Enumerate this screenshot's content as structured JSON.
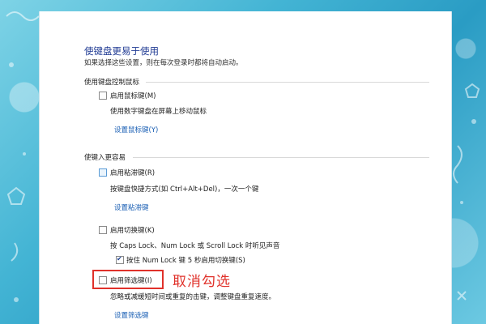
{
  "header": {
    "title": "使键盘更易于使用",
    "subtitle": "如果选择这些设置，则在每次登录时都将自动启动。"
  },
  "mouse_section": {
    "heading": "使用键盘控制鼠标",
    "mouse_keys": {
      "label": "启用鼠标键(M)",
      "checked": false,
      "description": "使用数字键盘在屏幕上移动鼠标",
      "setup_link": "设置鼠标键(Y)"
    }
  },
  "typing_section": {
    "heading": "使键入更容易",
    "sticky_keys": {
      "label": "启用粘滞键(R)",
      "checked": false,
      "description": "按键盘快捷方式(如 Ctrl+Alt+Del)，一次一个键",
      "setup_link": "设置粘滞键"
    },
    "toggle_keys": {
      "label": "启用切换键(K)",
      "checked": false,
      "description": "按 Caps Lock、Num Lock 或 Scroll Lock 时听见声音",
      "sub_option": {
        "label": "按住 Num Lock 键 5 秒启用切换键(S)",
        "checked": true
      }
    },
    "filter_keys": {
      "label": "启用筛选键(I)",
      "checked": false,
      "description": "忽略或减缓短时间或重复的击键，调整键盘重复速度。",
      "setup_link": "设置筛选键"
    }
  },
  "annotation": {
    "text": "取消勾选",
    "color": "#e0312a"
  }
}
